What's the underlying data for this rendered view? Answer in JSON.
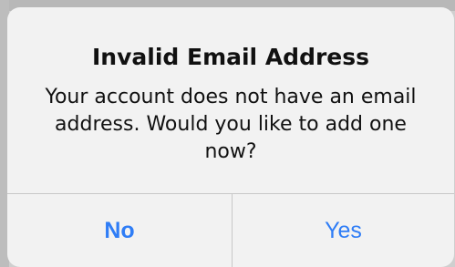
{
  "alert": {
    "title": "Invalid Email Address",
    "message": "Your account does not have an email address. Would you like to add one now?",
    "buttons": {
      "no_label": "No",
      "yes_label": "Yes"
    },
    "accent_color": "#2f7df6"
  }
}
